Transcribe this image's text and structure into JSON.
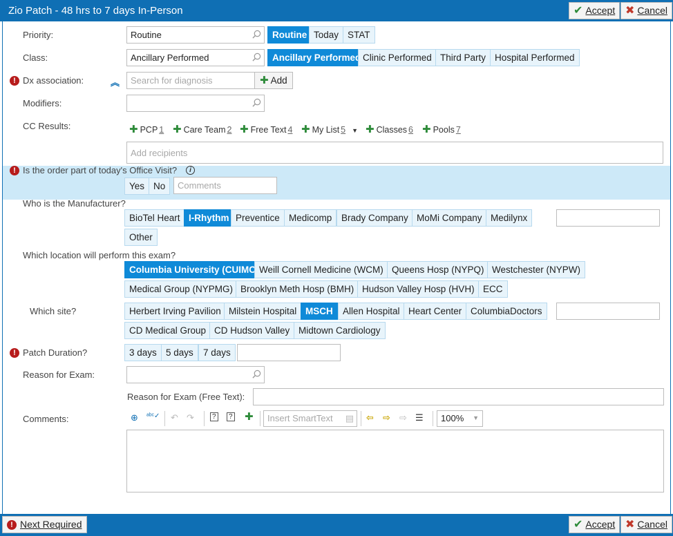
{
  "window": {
    "title": "Zio Patch - 48 hrs to 7 days In-Person",
    "accept_label": "Accept",
    "cancel_label": "Cancel"
  },
  "priority": {
    "label": "Priority:",
    "value": "Routine",
    "options": [
      "Routine",
      "Today",
      "STAT"
    ],
    "selected": "Routine"
  },
  "class_field": {
    "label": "Class:",
    "value": "Ancillary Performed",
    "options": [
      "Ancillary Performed",
      "Clinic Performed",
      "Third Party",
      "Hospital Performed"
    ],
    "selected": "Ancillary Performed"
  },
  "dx": {
    "label": "Dx association:",
    "placeholder": "Search for diagnosis",
    "add_label": "Add"
  },
  "modifiers": {
    "label": "Modifiers:"
  },
  "cc_results": {
    "label": "CC Results:",
    "items": [
      {
        "label": "PCP",
        "num": "1"
      },
      {
        "label": "Care Team",
        "num": "2"
      },
      {
        "label": "Free Text",
        "num": "4"
      },
      {
        "label": "My List",
        "num": "5"
      },
      {
        "label": "Classes",
        "num": "6"
      },
      {
        "label": "Pools",
        "num": "7"
      }
    ],
    "recipients_placeholder": "Add recipients"
  },
  "office_visit": {
    "question": "Is the order part of today's Office Visit?",
    "options": [
      "Yes",
      "No"
    ],
    "comments_placeholder": "Comments"
  },
  "manufacturer": {
    "question": "Who is the Manufacturer?",
    "options": [
      "BioTel Heart",
      "I-Rhythm",
      "Preventice",
      "Medicomp",
      "Brady Company",
      "MoMi Company",
      "Medilynx",
      "Other"
    ],
    "selected": "I-Rhythm"
  },
  "location": {
    "question": "Which location will perform this exam?",
    "options": [
      "Columbia University (CUIMC)",
      "Weill Cornell Medicine (WCM)",
      "Queens Hosp (NYPQ)",
      "Westchester (NYPW)",
      "Medical Group (NYPMG)",
      "Brooklyn Meth Hosp (BMH)",
      "Hudson Valley Hosp (HVH)",
      "ECC"
    ],
    "selected": "Columbia University (CUIMC)"
  },
  "site": {
    "question": "Which site?",
    "options": [
      "Herbert Irving Pavilion",
      "Milstein Hospital",
      "MSCH",
      "Allen Hospital",
      "Heart Center",
      "ColumbiaDoctors",
      "CD Medical Group",
      "CD Hudson Valley",
      "Midtown Cardiology"
    ],
    "selected": "MSCH"
  },
  "patch_duration": {
    "question": "Patch Duration?",
    "options": [
      "3 days",
      "5 days",
      "7 days"
    ]
  },
  "reason": {
    "label": "Reason for Exam:",
    "free_text_label": "Reason for Exam (Free Text):"
  },
  "comments": {
    "label": "Comments:",
    "smarttext_placeholder": "Insert SmartText",
    "zoom": "100%"
  },
  "footer": {
    "next_required_label": "Next Required",
    "accept_label": "Accept",
    "cancel_label": "Cancel"
  },
  "colors": {
    "title_bar": "#0f6fb4",
    "selected_pill": "#0f8ad8",
    "pill": "#e8f4fb",
    "band": "#cde9f8",
    "required": "#b71c1c",
    "add_green": "#2e8b3a"
  }
}
